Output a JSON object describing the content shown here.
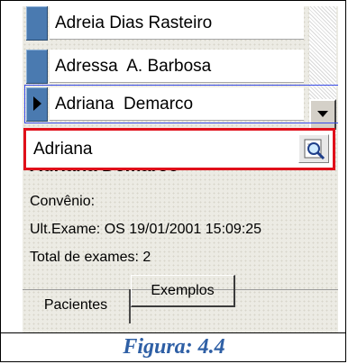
{
  "patient_list": {
    "rows": [
      {
        "name": "Adreia Dias Rasteiro"
      },
      {
        "name": "Adressa  A. Barbosa"
      },
      {
        "name": "Adriana  Demarco"
      }
    ]
  },
  "search": {
    "value": "Adriana"
  },
  "details": {
    "selected_name": "Adriana  Demarco",
    "convenio_label": "Convênio:",
    "ult_exame": "Ult.Exame: OS 19/01/2001 15:09:25",
    "total_exames": "Total de exames: 2"
  },
  "tabs": [
    {
      "label": "Pacientes",
      "active": true
    },
    {
      "label": "Exemplos",
      "active": false
    }
  ],
  "caption": "Figura: 4.4",
  "colors": {
    "highlight_border": "#e0101a",
    "selection_border": "#3a4de8",
    "row_indicator": "#4a7ab0",
    "caption": "#2e5fa5"
  }
}
